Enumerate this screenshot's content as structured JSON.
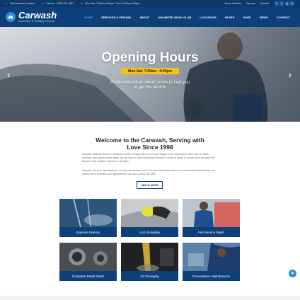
{
  "topbar": {
    "location": "Find Nearest Location",
    "phone": "Call Us: 1-800-123-4567",
    "hours": "Mon-Sat: 7:00am-6:00pm / Sun: 8:00am-6:00pm",
    "links": [
      "News & Media",
      "Careers",
      "Contact"
    ],
    "social": [
      "f",
      "t",
      "g",
      "in"
    ]
  },
  "header": {
    "logo_name": "Carwash",
    "logo_tagline": "Automotive & Detailing template",
    "nav": [
      "HOME",
      "SERVICES & PRICING",
      "ABOUT",
      "UNLIMITED WASH CLUB",
      "LOCATIONS",
      "PAGES",
      "SHOP",
      "NEWS",
      "CONTACT"
    ],
    "active_nav": "HOME"
  },
  "hero": {
    "title": "Opening Hours",
    "badge": "Mon-Sat: 7:00am - 6:00pm",
    "subtitle_line1": "Professional Auto detail centre to help you",
    "subtitle_line2": "to get the vehicle",
    "prev_icon": "chevron-left-icon",
    "next_icon": "chevron-right-icon"
  },
  "welcome": {
    "title_line1": "Welcome to the Carwash, Serving with",
    "title_line2": "Love Since 1998",
    "paragraph1": "Carwash made its debut in Columbus in 1998, bringing with us a 40-year legacy in the convenience store and car wash business from across seven states, we are built on brand by giving customers a sense of luxury in a place most accurate and fair price they wouldn't expect in a car wash",
    "paragraph2": "Carwash isn't your main business, but it is ours and we love it! For more information about our commercial wash services and pricing and to schedule your appointment, call us at 1 (800) 123-4567",
    "button": "ABOUT MORE"
  },
  "services": [
    {
      "label": "Express Exterior"
    },
    {
      "label": "Auto Detailing"
    },
    {
      "label": "Full Service Wash"
    },
    {
      "label": "Complete Detail Wash"
    },
    {
      "label": "Oil Changing"
    },
    {
      "label": "Preventative Maintenance"
    }
  ],
  "colors": {
    "topbar": "#0c3a6b",
    "header": "#0d3f78",
    "accent": "#3fa2ec",
    "badge": "#f4c21b"
  }
}
